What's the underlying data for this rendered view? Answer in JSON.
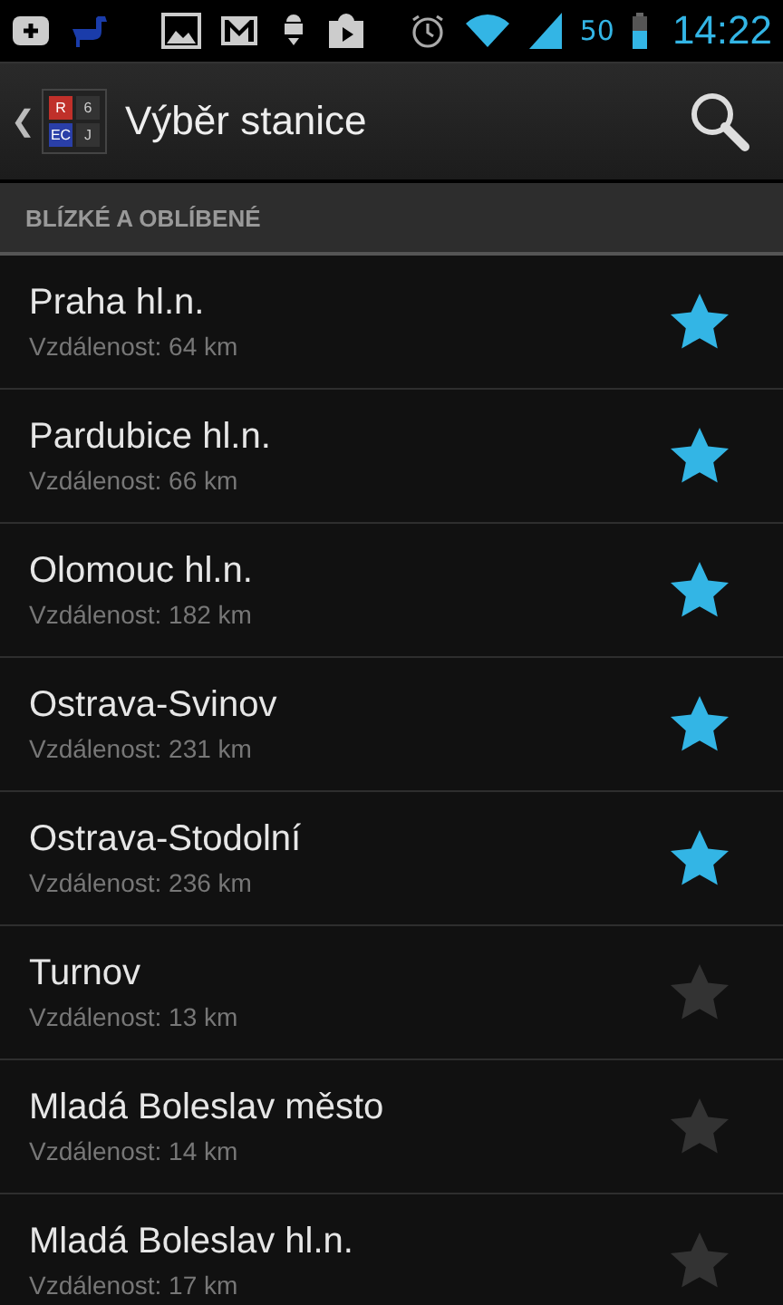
{
  "status_bar": {
    "battery_percent": "50",
    "time": "14:22"
  },
  "action_bar": {
    "back": "❮",
    "logo": [
      "R",
      "6",
      "EC",
      "J"
    ],
    "title": "Výběr stanice"
  },
  "section": {
    "title": "BLÍZKÉ A OBLÍBENÉ"
  },
  "stations": [
    {
      "name": "Praha hl.n.",
      "distance": "Vzdálenost: 64 km",
      "favorite": true
    },
    {
      "name": "Pardubice hl.n.",
      "distance": "Vzdálenost: 66 km",
      "favorite": true
    },
    {
      "name": "Olomouc hl.n.",
      "distance": "Vzdálenost: 182 km",
      "favorite": true
    },
    {
      "name": "Ostrava-Svinov",
      "distance": "Vzdálenost: 231 km",
      "favorite": true
    },
    {
      "name": "Ostrava-Stodolní",
      "distance": "Vzdálenost: 236 km",
      "favorite": true
    },
    {
      "name": "Turnov",
      "distance": "Vzdálenost: 13 km",
      "favorite": false
    },
    {
      "name": "Mladá Boleslav město",
      "distance": "Vzdálenost: 14 km",
      "favorite": false
    },
    {
      "name": "Mladá Boleslav hl.n.",
      "distance": "Vzdálenost: 17 km",
      "favorite": false
    }
  ]
}
